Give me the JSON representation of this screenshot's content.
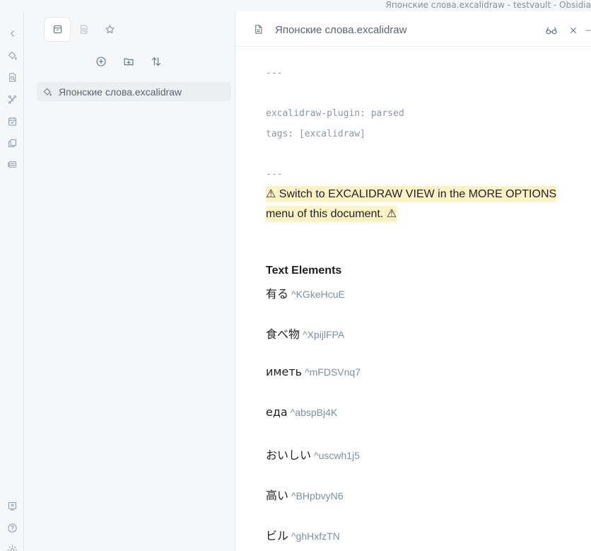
{
  "window": {
    "title": "Японские слова.excalidraw - testvault - Obsidia"
  },
  "ribbon": {
    "icons": [
      "collapse-left-icon",
      "paint-bucket-icon",
      "file-search-icon",
      "graph-icon",
      "calendar-check-icon",
      "copy-files-icon",
      "slides-icon",
      "vault-icon",
      "help-icon",
      "settings-icon"
    ]
  },
  "sidebar": {
    "tabs": [
      "files-tab",
      "search-tab",
      "bookmarks-tab"
    ],
    "actions": [
      "new-note-button",
      "new-folder-button",
      "sort-button"
    ],
    "files": [
      {
        "name": "Японские слова.excalidraw"
      }
    ]
  },
  "editor": {
    "tab_title": "Японские слова.excalidraw",
    "frontmatter": {
      "delimiter_top": "---",
      "line1": "excalidraw-plugin: parsed",
      "line2": "tags: [excalidraw]",
      "delimiter_bottom": "---"
    },
    "warning": {
      "line1": "⚠ Switch to EXCALIDRAW VIEW in the MORE OPTIONS",
      "line2": "menu of this document. ⚠"
    },
    "section_heading": "Text Elements",
    "elements": [
      {
        "text": "有る",
        "ref": "^KGkeHcuE"
      },
      {
        "text": "食べ物",
        "ref": "^XpijlFPA"
      },
      {
        "text": "иметь",
        "ref": "^mFDSVnq7"
      },
      {
        "text": "еда",
        "ref": "^abspBj4K"
      },
      {
        "text": "おいしい",
        "ref": "^uscwh1j5"
      },
      {
        "text": "高い",
        "ref": "^BHpbvyN6"
      },
      {
        "text": "ビル",
        "ref": "^ghHxfzTN"
      }
    ]
  }
}
